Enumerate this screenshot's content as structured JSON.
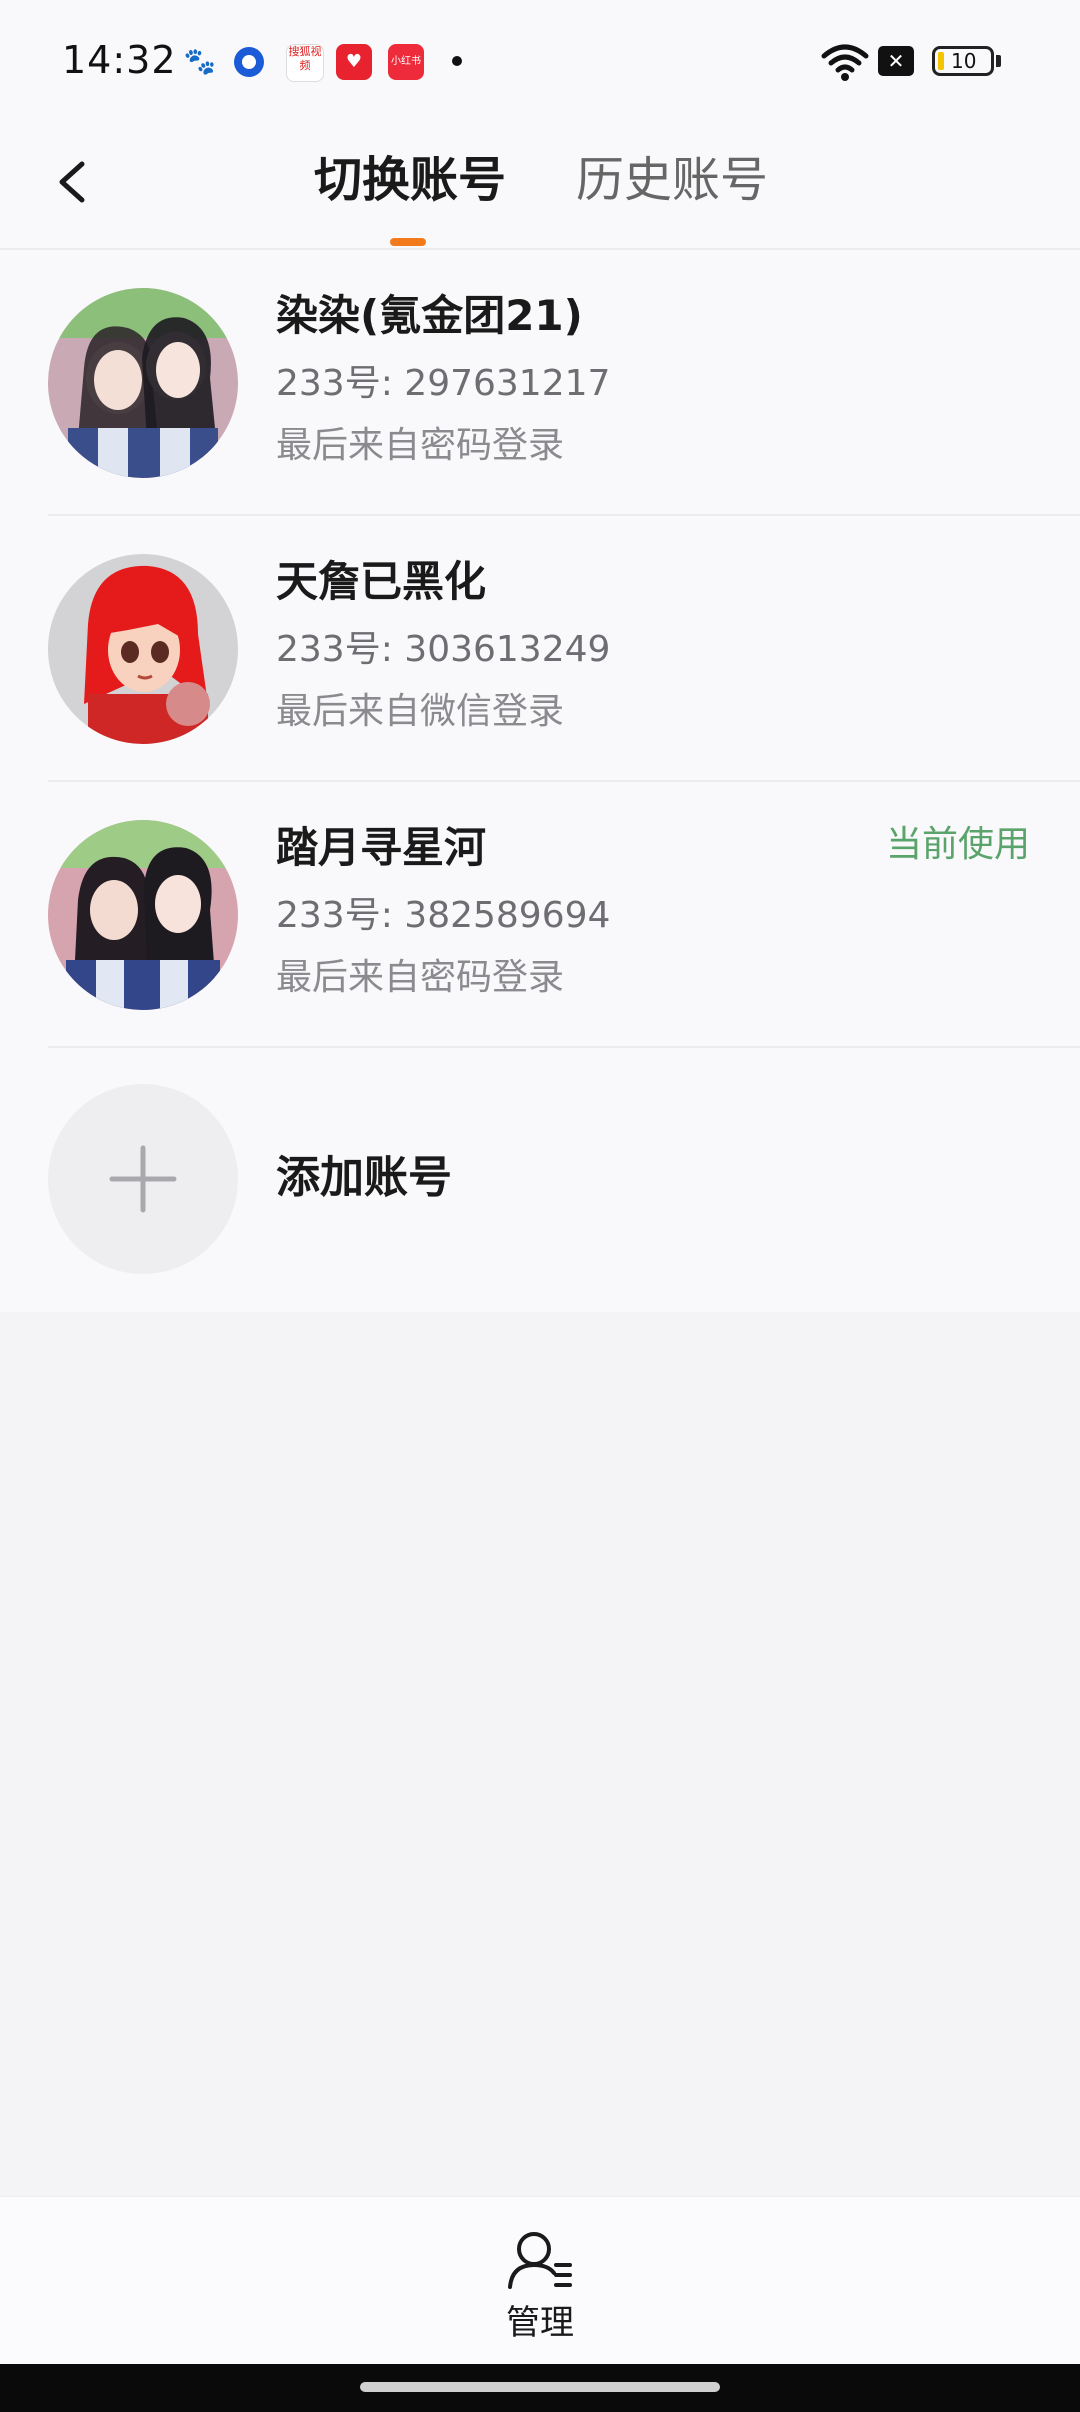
{
  "status_bar": {
    "time": "14:32",
    "notifications": [
      "baidu-icon",
      "ring-app-icon",
      "sohu-video-icon",
      "heart-app-icon",
      "xiaohongshu-icon"
    ],
    "sohu_label": "搜狐视频",
    "xhs_label": "小红书",
    "battery": "10"
  },
  "header": {
    "tabs": [
      {
        "label": "切换账号",
        "active": true
      },
      {
        "label": "历史账号",
        "active": false
      }
    ],
    "accent_color": "#f27a1a"
  },
  "accounts": [
    {
      "name": "染染(氪金团21)",
      "uid": "233号: 297631217",
      "login": "最后来自密码登录",
      "current": ""
    },
    {
      "name": "天詹已黑化",
      "uid": "233号: 303613249",
      "login": "最后来自微信登录",
      "current": ""
    },
    {
      "name": "踏月寻星河",
      "uid": "233号: 382589694",
      "login": "最后来自密码登录",
      "current": "当前使用"
    }
  ],
  "add_account": {
    "label": "添加账号"
  },
  "bottom": {
    "manage_label": "管理"
  },
  "colors": {
    "current_badge": "#5aa36b"
  }
}
